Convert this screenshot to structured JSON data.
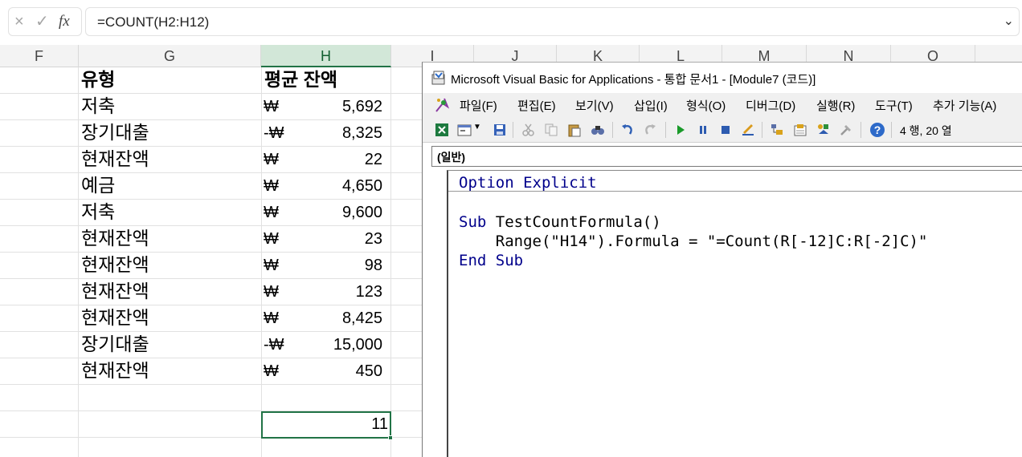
{
  "formula_bar": {
    "cancel_icon": "×",
    "enter_icon": "✓",
    "fx_label": "fx",
    "formula": "=COUNT(H2:H12)",
    "dropdown_icon": "⌄"
  },
  "columns": {
    "F": "F",
    "G": "G",
    "H": "H",
    "I": "I",
    "J": "J",
    "K": "K",
    "L": "L",
    "M": "M",
    "N": "N",
    "O": "O"
  },
  "sheet": {
    "header": {
      "type": "유형",
      "balance": "평균 잔액"
    },
    "rows": [
      {
        "type": "저축",
        "won": "₩",
        "value": "5,692"
      },
      {
        "type": "장기대출",
        "won": "-₩",
        "value": "8,325"
      },
      {
        "type": "현재잔액",
        "won": "₩",
        "value": "22"
      },
      {
        "type": "예금",
        "won": "₩",
        "value": "4,650"
      },
      {
        "type": "저축",
        "won": "₩",
        "value": "9,600"
      },
      {
        "type": "현재잔액",
        "won": "₩",
        "value": "23"
      },
      {
        "type": "현재잔액",
        "won": "₩",
        "value": "98"
      },
      {
        "type": "현재잔액",
        "won": "₩",
        "value": "123"
      },
      {
        "type": "현재잔액",
        "won": "₩",
        "value": "8,425"
      },
      {
        "type": "장기대출",
        "won": "-₩",
        "value": "15,000"
      },
      {
        "type": "현재잔액",
        "won": "₩",
        "value": "450"
      }
    ],
    "count_result": "11"
  },
  "vba": {
    "title": "Microsoft Visual Basic for Applications - 통합 문서1 - [Module7 (코드)]",
    "menu": [
      "파일(F)",
      "편집(E)",
      "보기(V)",
      "삽입(I)",
      "형식(O)",
      "디버그(D)",
      "실행(R)",
      "도구(T)",
      "추가 기능(A)"
    ],
    "cursor_position": "4 행, 20 열",
    "object_combo": "(일반)",
    "code": {
      "line1_kw": "Option Explicit",
      "line3_kw": "Sub",
      "line3_rest": " TestCountFormula()",
      "line4": "    Range(\"H14\").Formula = \"=Count(R[-12]C:R[-2]C)\"",
      "line5_kw": "End Sub"
    }
  }
}
